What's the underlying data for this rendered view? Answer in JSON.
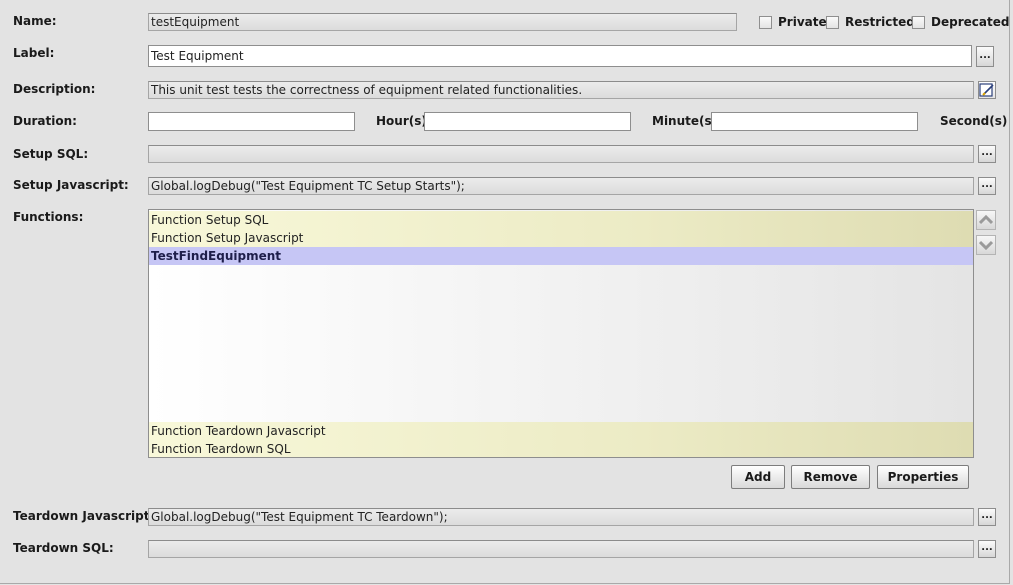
{
  "form": {
    "name_label": "Name:",
    "name_value": "testEquipment",
    "private_label": "Private",
    "restricted_label": "Restricted",
    "deprecated_label": "Deprecated",
    "label_label": "Label:",
    "label_value": "Test Equipment",
    "description_label": "Description:",
    "description_value": "This unit test tests the correctness of equipment related functionalities.",
    "duration_label": "Duration:",
    "hours_value": "",
    "hours_unit": "Hour(s)",
    "minutes_value": "",
    "minutes_unit": "Minute(s)",
    "seconds_value": "",
    "seconds_unit": "Second(s)",
    "setup_sql_label": "Setup SQL:",
    "setup_sql_value": "",
    "setup_js_label": "Setup Javascript:",
    "setup_js_value": "Global.logDebug(\"Test Equipment TC Setup Starts\");",
    "functions_label": "Functions:",
    "teardown_js_label": "Teardown Javascript:",
    "teardown_js_value": "Global.logDebug(\"Test Equipment TC Teardown\");",
    "teardown_sql_label": "Teardown SQL:",
    "teardown_sql_value": "",
    "ellipsis": "..."
  },
  "functions": {
    "top_items": [
      "Function Setup SQL",
      "Function Setup Javascript"
    ],
    "selected_item": "TestFindEquipment",
    "bottom_items": [
      "Function Teardown Javascript",
      "Function Teardown SQL"
    ]
  },
  "buttons": {
    "add": "Add",
    "remove": "Remove",
    "properties": "Properties"
  },
  "icons": {
    "edit": "edit-icon",
    "up": "move-up-icon",
    "down": "move-down-icon"
  }
}
